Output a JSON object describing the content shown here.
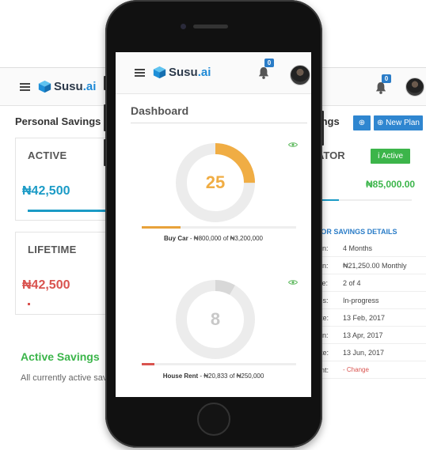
{
  "app": {
    "logo_main": "Susu",
    "logo_suffix": ".ai"
  },
  "colors": {
    "accent_blue": "#2a7cc7",
    "green": "#3bb54a",
    "red": "#d9534f",
    "orange": "#f0ad44",
    "gray_ring": "#ececec"
  },
  "desktop_left": {
    "section_title": "Personal Savings",
    "cards": [
      {
        "label": "ACTIVE",
        "amount": "₦42,500",
        "progress": 0.75
      },
      {
        "label": "LIFETIME",
        "amount": "₦42,500",
        "progress": 0.02
      }
    ],
    "active_savings_title": "Active Savings",
    "active_savings_desc": "All currently active sav"
  },
  "desktop_right": {
    "notification_count": "0",
    "partial_title": "ings",
    "new_plan_label": "New Plan",
    "status_label": "Active",
    "ator_label": "ATOR",
    "amount": "₦85,000.00",
    "details_header": "TOR SAVINGS DETAILS",
    "details": [
      {
        "key": "ion:",
        "value": "4 Months"
      },
      {
        "key": "ion:",
        "value": "₦21,250.00 Monthly"
      },
      {
        "key": "cle:",
        "value": "2 of 4"
      },
      {
        "key": "tus:",
        "value": "In-progress"
      },
      {
        "key": "ate:",
        "value": "13 Feb, 2017"
      },
      {
        "key": "ion:",
        "value": "13 Apr, 2017"
      },
      {
        "key": "ate:",
        "value": "13 Jun, 2017"
      },
      {
        "key": "unt:",
        "value": "- Change"
      }
    ]
  },
  "phone": {
    "notification_count": "0",
    "dashboard_title": "Dashboard",
    "plans": [
      {
        "value": "25",
        "fraction": 0.25,
        "color": "#f0ad44",
        "name": "Buy Car",
        "detail": " - ₦800,000 of ₦3,200,000",
        "progress": 0.25,
        "progress_color": "#e8a23a"
      },
      {
        "value": "8",
        "fraction": 0.083,
        "color": "#d8d8d8",
        "name": "House Rent",
        "detail": " - ₦20,833 of ₦250,000",
        "progress": 0.08,
        "progress_color": "#d9534f"
      }
    ]
  }
}
